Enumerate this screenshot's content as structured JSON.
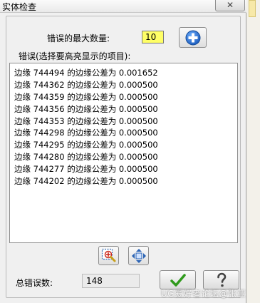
{
  "window": {
    "title": "实体检查",
    "close_glyph": "✕"
  },
  "max_errors": {
    "label": "错误的最大数量:",
    "value": "10"
  },
  "list": {
    "label": "错误(选择要高亮显示的项目):",
    "items": [
      "边缘 744494 的边缘公差为 0.001652",
      "边缘 744362 的边缘公差为 0.000500",
      "边缘 744359 的边缘公差为 0.000500",
      "边缘 744356 的边缘公差为 0.000500",
      "边缘 744353 的边缘公差为 0.000500",
      "边缘 744298 的边缘公差为 0.000500",
      "边缘 744295 的边缘公差为 0.000500",
      "边缘 744280 的边缘公差为 0.000500",
      "边缘 744277 的边缘公差为 0.000500",
      "边缘 744202 的边缘公差为 0.000500"
    ]
  },
  "total": {
    "label": "总错误数:",
    "value": "148"
  },
  "watermark": "UG爱好者论坛@张亚",
  "icons": {
    "plus": "plus-circle-icon",
    "zoom": "zoom-highlight-icon",
    "fit": "fit-arrows-icon",
    "ok": "checkmark-icon",
    "help": "question-mark-icon"
  },
  "colors": {
    "input_highlight": "#ffff66",
    "plus_blue": "#1f6fcf",
    "ok_green": "#2f9a1c"
  }
}
